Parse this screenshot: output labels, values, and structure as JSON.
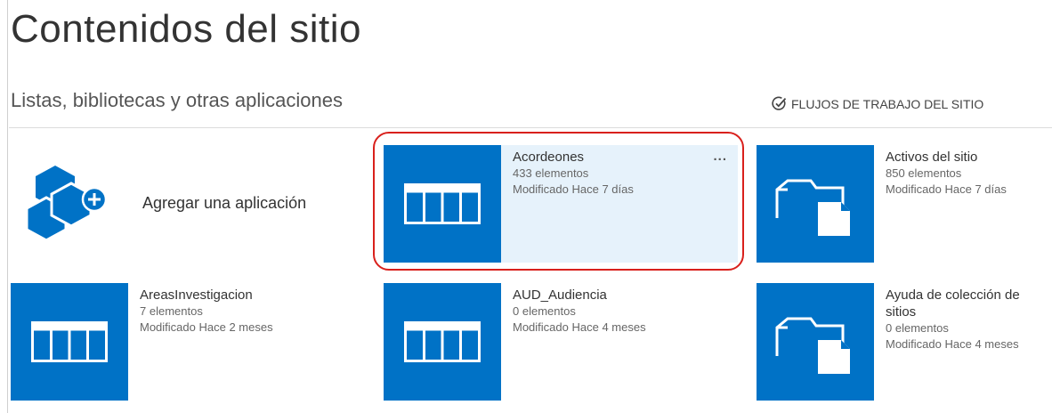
{
  "page": {
    "title": "Contenidos del sitio",
    "section_title": "Listas, bibliotecas y otras aplicaciones",
    "workflows_label": "FLUJOS DE TRABAJO DEL SITIO",
    "workflows_icon": "check-circle-icon",
    "add_app_label": "Agregar una aplicación",
    "add_app_icon": "add-app-icon",
    "accent_color": "#0072c6",
    "highlight_color": "#d9201c"
  },
  "tiles": [
    {
      "name": "Acordeones",
      "count": "433 elementos",
      "modified": "Modificado Hace 7 días",
      "icon": "list-icon",
      "more": "...",
      "selected": true
    },
    {
      "name": "Activos del sitio",
      "count": "850 elementos",
      "modified": "Modificado Hace 7 días",
      "icon": "library-icon"
    },
    {
      "name": "AreasInvestigacion",
      "count": "7 elementos",
      "modified": "Modificado Hace 2 meses",
      "icon": "list-icon"
    },
    {
      "name": "AUD_Audiencia",
      "count": "0 elementos",
      "modified": "Modificado Hace 4 meses",
      "icon": "list-icon"
    },
    {
      "name": "Ayuda de colección de sitios",
      "count": "0 elementos",
      "modified": "Modificado Hace 4 meses",
      "icon": "library-icon"
    }
  ]
}
